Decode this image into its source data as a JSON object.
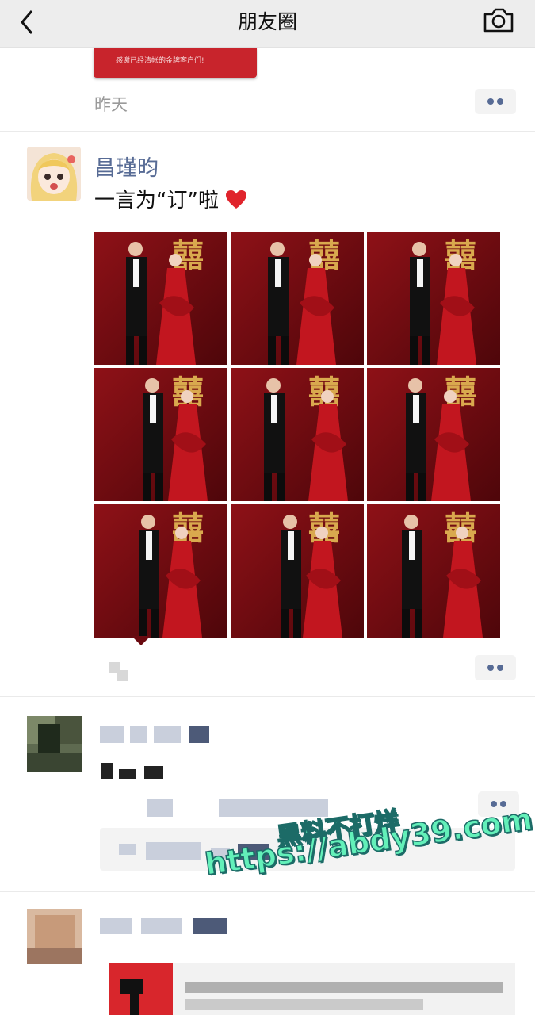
{
  "nav": {
    "title": "朋友圈",
    "back_icon": "chevron-left-icon",
    "camera_icon": "camera-icon",
    "background": "#ededed"
  },
  "prev_post": {
    "banner_text": "感谢已经清帐的金牌客户们!",
    "banner_color": "#c8242c",
    "time": "昨天"
  },
  "post": {
    "user_name": "昌瑾昀",
    "text": "一言为“订”啦",
    "emoji": "heart-icon",
    "name_color": "#576b95",
    "photos": [
      {
        "label": "photo-1"
      },
      {
        "label": "photo-2"
      },
      {
        "label": "photo-3"
      },
      {
        "label": "photo-4"
      },
      {
        "label": "photo-5"
      },
      {
        "label": "photo-6"
      },
      {
        "label": "photo-7"
      },
      {
        "label": "photo-8"
      },
      {
        "label": "photo-9"
      }
    ],
    "photo_bg_color": "#7a0d12",
    "photo_decoration": "囍"
  },
  "watermark": {
    "line1": "黑料不打烊",
    "line2": "https://abdy39.com",
    "color": "#63f0b9"
  }
}
